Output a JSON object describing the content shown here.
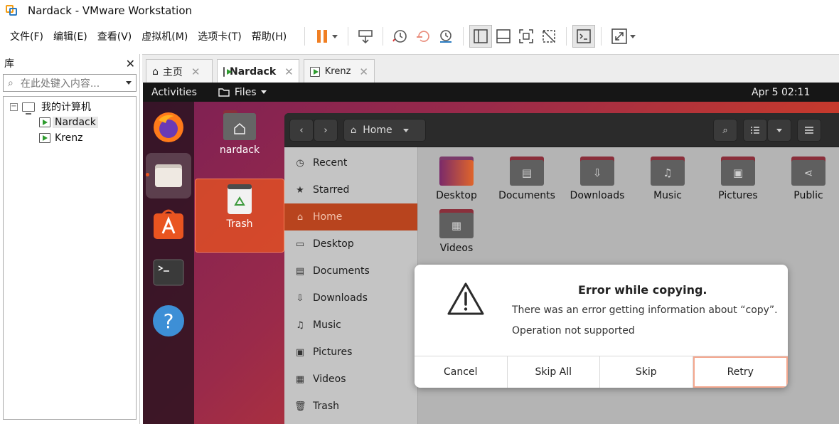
{
  "window": {
    "title": "Nardack - VMware Workstation"
  },
  "menu": [
    "文件(F)",
    "编辑(E)",
    "查看(V)",
    "虚拟机(M)",
    "选项卡(T)",
    "帮助(H)"
  ],
  "library": {
    "title": "库",
    "search_placeholder": "在此处键入内容...",
    "root": "我的计算机",
    "vms": [
      "Nardack",
      "Krenz"
    ]
  },
  "tabs": [
    {
      "label": "主页",
      "icon": "home-icon"
    },
    {
      "label": "Nardack",
      "icon": "vm-icon"
    },
    {
      "label": "Krenz",
      "icon": "vm-icon"
    }
  ],
  "ubuntu": {
    "activities": "Activities",
    "app_menu": "Files",
    "clock": "Apr 5  02:11",
    "desktop_icons": [
      "nardack",
      "Trash"
    ]
  },
  "nautilus": {
    "location": "Home",
    "sidebar": [
      {
        "label": "Recent",
        "icon": "clock-icon"
      },
      {
        "label": "Starred",
        "icon": "star-icon"
      },
      {
        "label": "Home",
        "icon": "home-icon"
      },
      {
        "label": "Desktop",
        "icon": "desktop-icon"
      },
      {
        "label": "Documents",
        "icon": "document-icon"
      },
      {
        "label": "Downloads",
        "icon": "download-icon"
      },
      {
        "label": "Music",
        "icon": "music-icon"
      },
      {
        "label": "Pictures",
        "icon": "picture-icon"
      },
      {
        "label": "Videos",
        "icon": "video-icon"
      },
      {
        "label": "Trash",
        "icon": "trash-icon"
      }
    ],
    "folders": [
      "Desktop",
      "Documents",
      "Downloads",
      "Music",
      "Pictures",
      "Public",
      "Videos"
    ]
  },
  "dialog": {
    "title": "Error while copying.",
    "message": "There was an error getting information about “copy”.",
    "secondary": "Operation not supported",
    "buttons": [
      "Cancel",
      "Skip All",
      "Skip",
      "Retry"
    ]
  },
  "colors": {
    "ubuntu_orange": "#e95420",
    "vmware_orange": "#f39c12"
  }
}
